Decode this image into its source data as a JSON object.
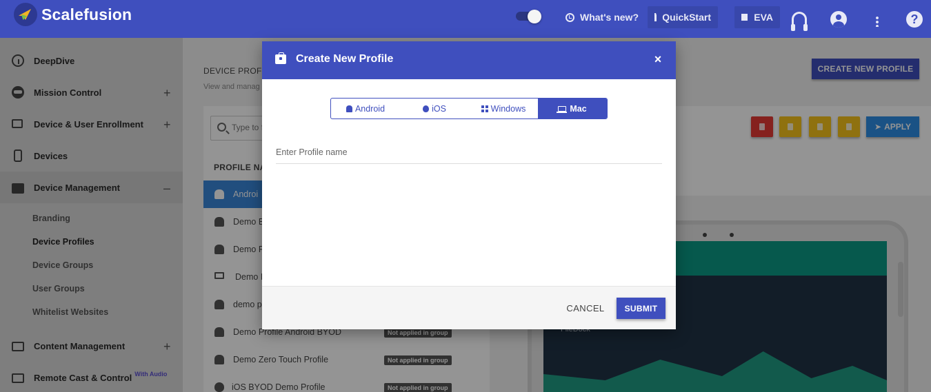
{
  "header": {
    "brand": "Scalefusion",
    "whats_new": "What's new?",
    "quickstart": "QuickStart",
    "eva": "EVA",
    "help": "?"
  },
  "sidebar": {
    "items": [
      {
        "label": "DeepDive",
        "icon": "gauge-icon"
      },
      {
        "label": "Mission Control",
        "icon": "robot-icon",
        "toggle": "+"
      },
      {
        "label": "Device & User Enrollment",
        "icon": "devices-icon",
        "toggle": "+"
      },
      {
        "label": "Devices",
        "icon": "phone-icon"
      },
      {
        "label": "Device Management",
        "icon": "briefcase-icon",
        "toggle": "–"
      },
      {
        "label": "Content Management",
        "icon": "folder-icon",
        "toggle": "+"
      },
      {
        "label": "Remote Cast & Control",
        "icon": "cast-icon",
        "suffix": "With Audio"
      }
    ],
    "subitems": [
      "Branding",
      "Device Profiles",
      "Device Groups",
      "User Groups",
      "Whitelist Websites"
    ]
  },
  "main": {
    "title": "DEVICE PROF",
    "subtitle": "View and manag",
    "create_button": "CREATE NEW PROFILE",
    "search_placeholder": "Type to f",
    "column_header": "PROFILE NA",
    "apply_button": "APPLY",
    "profiles": [
      {
        "name": "Androi",
        "badge": ""
      },
      {
        "name": "Demo B",
        "badge": ""
      },
      {
        "name": "Demo F",
        "badge": ""
      },
      {
        "name": "Demo I",
        "badge": ""
      },
      {
        "name": "demo p",
        "badge": ""
      },
      {
        "name": "Demo Profile Android BYOD",
        "badge": "Not applied in group"
      },
      {
        "name": "Demo Zero Touch Profile",
        "badge": "Not applied in group"
      },
      {
        "name": "iOS BYOD Demo Profile",
        "badge": "Not applied in group"
      }
    ],
    "device_preview_label": "FileDock"
  },
  "modal": {
    "title": "Create New Profile",
    "close": "×",
    "tabs": [
      {
        "label": "Android",
        "icon": "android-icon",
        "active": false
      },
      {
        "label": "iOS",
        "icon": "apple-icon",
        "active": false
      },
      {
        "label": "Windows",
        "icon": "windows-icon",
        "active": false
      },
      {
        "label": "Mac",
        "icon": "laptop-icon",
        "active": true
      }
    ],
    "name_placeholder": "Enter Profile name",
    "name_value": "",
    "cancel": "CANCEL",
    "submit": "SUBMIT"
  },
  "colors": {
    "primary": "#3f4fbe",
    "selected_row": "#3a87d9",
    "delete": "#e53935",
    "warning": "#f7c31b",
    "apply": "#2e8de5"
  }
}
